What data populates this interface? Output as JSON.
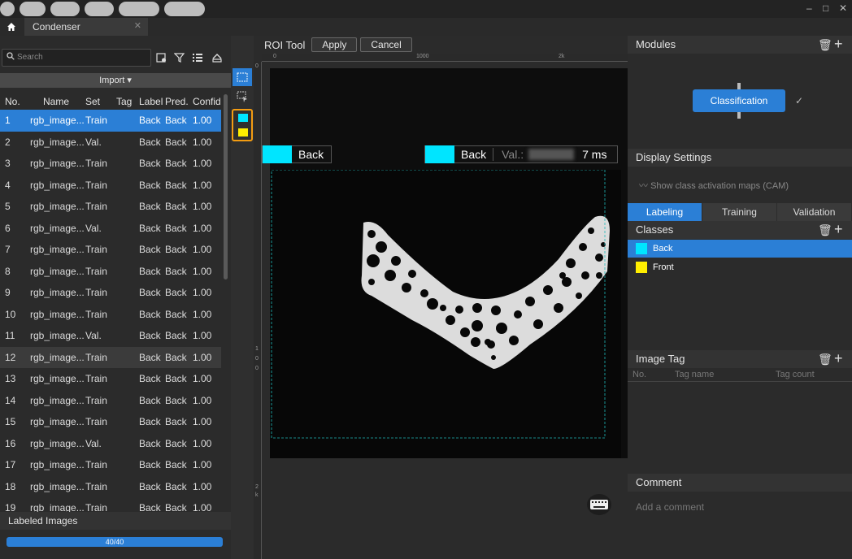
{
  "window": {
    "tab": "Condenser",
    "controls": [
      "–",
      "□",
      "✕"
    ]
  },
  "left": {
    "search_placeholder": "Search",
    "import_label": "Import",
    "headers": [
      "No.",
      "Name",
      "Set",
      "Tag",
      "Label",
      "Pred.",
      "Confid."
    ],
    "rows": [
      {
        "no": "1",
        "name": "rgb_image...",
        "set": "Train",
        "tag": "",
        "label": "Back",
        "pred": "Back",
        "conf": "1.00"
      },
      {
        "no": "2",
        "name": "rgb_image...",
        "set": "Val.",
        "tag": "",
        "label": "Back",
        "pred": "Back",
        "conf": "1.00"
      },
      {
        "no": "3",
        "name": "rgb_image...",
        "set": "Train",
        "tag": "",
        "label": "Back",
        "pred": "Back",
        "conf": "1.00"
      },
      {
        "no": "4",
        "name": "rgb_image...",
        "set": "Train",
        "tag": "",
        "label": "Back",
        "pred": "Back",
        "conf": "1.00"
      },
      {
        "no": "5",
        "name": "rgb_image...",
        "set": "Train",
        "tag": "",
        "label": "Back",
        "pred": "Back",
        "conf": "1.00"
      },
      {
        "no": "6",
        "name": "rgb_image...",
        "set": "Val.",
        "tag": "",
        "label": "Back",
        "pred": "Back",
        "conf": "1.00"
      },
      {
        "no": "7",
        "name": "rgb_image...",
        "set": "Train",
        "tag": "",
        "label": "Back",
        "pred": "Back",
        "conf": "1.00"
      },
      {
        "no": "8",
        "name": "rgb_image...",
        "set": "Train",
        "tag": "",
        "label": "Back",
        "pred": "Back",
        "conf": "1.00"
      },
      {
        "no": "9",
        "name": "rgb_image...",
        "set": "Train",
        "tag": "",
        "label": "Back",
        "pred": "Back",
        "conf": "1.00"
      },
      {
        "no": "10",
        "name": "rgb_image...",
        "set": "Train",
        "tag": "",
        "label": "Back",
        "pred": "Back",
        "conf": "1.00"
      },
      {
        "no": "11",
        "name": "rgb_image...",
        "set": "Val.",
        "tag": "",
        "label": "Back",
        "pred": "Back",
        "conf": "1.00"
      },
      {
        "no": "12",
        "name": "rgb_image...",
        "set": "Train",
        "tag": "",
        "label": "Back",
        "pred": "Back",
        "conf": "1.00"
      },
      {
        "no": "13",
        "name": "rgb_image...",
        "set": "Train",
        "tag": "",
        "label": "Back",
        "pred": "Back",
        "conf": "1.00"
      },
      {
        "no": "14",
        "name": "rgb_image...",
        "set": "Train",
        "tag": "",
        "label": "Back",
        "pred": "Back",
        "conf": "1.00"
      },
      {
        "no": "15",
        "name": "rgb_image...",
        "set": "Train",
        "tag": "",
        "label": "Back",
        "pred": "Back",
        "conf": "1.00"
      },
      {
        "no": "16",
        "name": "rgb_image...",
        "set": "Val.",
        "tag": "",
        "label": "Back",
        "pred": "Back",
        "conf": "1.00"
      },
      {
        "no": "17",
        "name": "rgb_image...",
        "set": "Train",
        "tag": "",
        "label": "Back",
        "pred": "Back",
        "conf": "1.00"
      },
      {
        "no": "18",
        "name": "rgb_image...",
        "set": "Train",
        "tag": "",
        "label": "Back",
        "pred": "Back",
        "conf": "1.00"
      },
      {
        "no": "19",
        "name": "rgb_image...",
        "set": "Train",
        "tag": "",
        "label": "Back",
        "pred": "Back",
        "conf": "1.00"
      }
    ],
    "selected_row": "1",
    "hover_row": "12",
    "labeled_title": "Labeled Images",
    "progress_text": "40/40",
    "progress_fraction": 1.0
  },
  "roi": {
    "title": "ROI Tool",
    "apply": "Apply",
    "cancel": "Cancel",
    "ruler_top": [
      "0",
      "1000",
      "2k"
    ],
    "ruler_left": [
      "0",
      "1",
      "0",
      "0",
      "2",
      "k"
    ]
  },
  "overlay": {
    "label_left": "Back",
    "label_right": "Back",
    "val_prefix": "Val.:",
    "time": "7 ms"
  },
  "right": {
    "modules_title": "Modules",
    "module_button": "Classification",
    "module_check": "✓",
    "display_title": "Display Settings",
    "cam_label": "Show class activation maps (CAM)",
    "tabs": [
      "Labeling",
      "Training",
      "Validation"
    ],
    "classes_title": "Classes",
    "classes": [
      {
        "name": "Back",
        "color": "#00e5ff"
      },
      {
        "name": "Front",
        "color": "#ffee00"
      }
    ],
    "image_tag_title": "Image Tag",
    "tag_cols": [
      "No.",
      "Tag name",
      "Tag count"
    ],
    "comment_title": "Comment",
    "comment_placeholder": "Add a comment"
  },
  "colors": {
    "accent": "#2b7fd6",
    "back": "#00e5ff",
    "front": "#ffee00",
    "highlight": "#f39c12"
  }
}
